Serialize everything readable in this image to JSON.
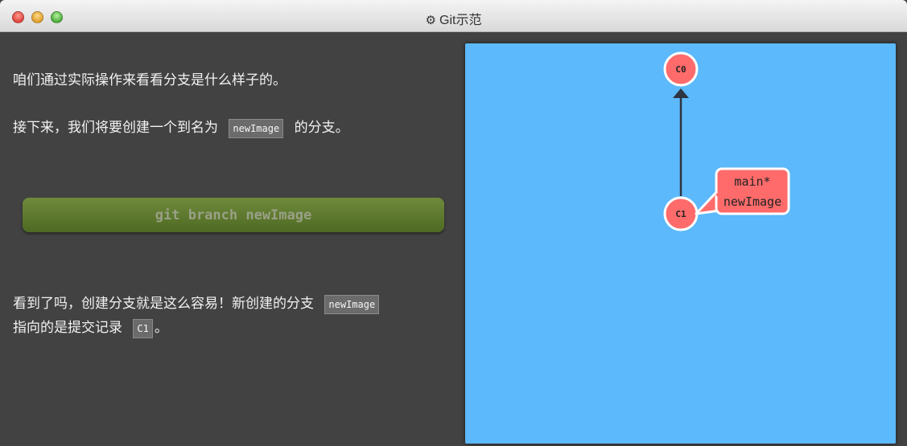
{
  "window": {
    "title": "Git示范",
    "title_icon": "gear-icon"
  },
  "lesson": {
    "line1": "咱们通过实际操作来看看分支是什么样子的。",
    "line2_prefix": "接下来，我们将要创建一个到名为",
    "line2_code": "newImage",
    "line2_suffix": "的分支。",
    "command": "git branch newImage",
    "line3_prefix": "看到了吗，创建分支就是这么容易！新创建的分支",
    "line3_code": "newImage",
    "line4_prefix": "指向的是提交记录",
    "line4_code": "C1",
    "line4_suffix": "。"
  },
  "graph": {
    "background": "#5cb9fb",
    "commit_color": "#ff6b6b",
    "commits": [
      {
        "id": "C0"
      },
      {
        "id": "C1"
      }
    ],
    "branch_label_lines": [
      "main*",
      "newImage"
    ]
  }
}
